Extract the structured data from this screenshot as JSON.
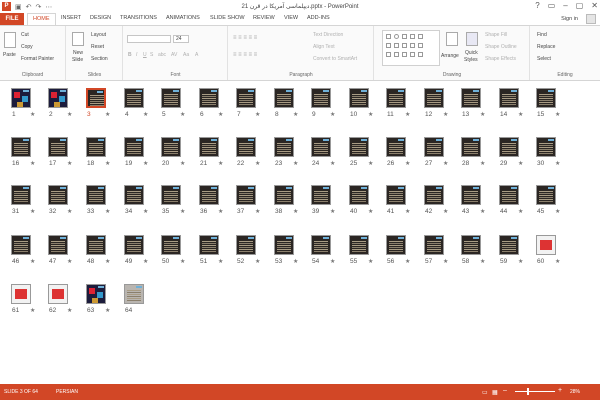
{
  "window": {
    "title": "21 دیپلماسی آمریکا در قرن.pptx - PowerPoint",
    "controls": [
      "?",
      "▭",
      "–",
      "▢",
      "✕"
    ]
  },
  "qat": {
    "logo": "P",
    "save": "▣",
    "undo": "↶",
    "redo": "↷",
    "customize": "⋯"
  },
  "tabs": [
    "FILE",
    "HOME",
    "INSERT",
    "DESIGN",
    "TRANSITIONS",
    "ANIMATIONS",
    "SLIDE SHOW",
    "REVIEW",
    "VIEW",
    "ADD-INS"
  ],
  "account": {
    "signin": "Sign in"
  },
  "ribbon": {
    "clipboard": {
      "paste": "Paste",
      "cut": "Cut",
      "copy": "Copy",
      "format_painter": "Format Painter",
      "label": "Clipboard"
    },
    "slides": {
      "new_slide_1": "New",
      "new_slide_2": "Slide",
      "layout": "Layout",
      "reset": "Reset",
      "section": "Section",
      "label": "Slides"
    },
    "font": {
      "size": "24",
      "bold": "B",
      "italic": "I",
      "underline": "U",
      "strike": "S",
      "shadow": "abc",
      "spacing": "AV",
      "case": "Aa",
      "color": "A",
      "label": "Font"
    },
    "paragraph": {
      "text_direction": "Text Direction",
      "align_text": "Align Text",
      "convert_smartart": "Convert to SmartArt",
      "label": "Paragraph"
    },
    "drawing": {
      "arrange": "Arrange",
      "quick_styles_1": "Quick",
      "quick_styles_2": "Styles",
      "shape_fill": "Shape Fill",
      "shape_outline": "Shape Outline",
      "shape_effects": "Shape Effects",
      "label": "Drawing"
    },
    "editing": {
      "find": "Find",
      "replace": "Replace",
      "select": "Select",
      "label": "Editing"
    }
  },
  "slides": [
    {
      "number": "1",
      "star": "★",
      "style": "photo"
    },
    {
      "number": "2",
      "star": "★",
      "style": "photo"
    },
    {
      "number": "3",
      "star": "★",
      "style": "selected"
    },
    {
      "number": "4",
      "star": "★"
    },
    {
      "number": "5",
      "star": "★"
    },
    {
      "number": "6",
      "star": "★"
    },
    {
      "number": "7",
      "star": "★"
    },
    {
      "number": "8",
      "star": "★"
    },
    {
      "number": "9",
      "star": "★"
    },
    {
      "number": "10",
      "star": "★"
    },
    {
      "number": "11",
      "star": "★"
    },
    {
      "number": "12",
      "star": "★"
    },
    {
      "number": "13",
      "star": "★"
    },
    {
      "number": "14",
      "star": "★"
    },
    {
      "number": "15",
      "star": "★"
    },
    {
      "number": "16",
      "star": "★"
    },
    {
      "number": "17",
      "star": "★"
    },
    {
      "number": "18",
      "star": "★"
    },
    {
      "number": "19",
      "star": "★"
    },
    {
      "number": "20",
      "star": "★"
    },
    {
      "number": "21",
      "star": "★"
    },
    {
      "number": "22",
      "star": "★"
    },
    {
      "number": "23",
      "star": "★"
    },
    {
      "number": "24",
      "star": "★"
    },
    {
      "number": "25",
      "star": "★"
    },
    {
      "number": "26",
      "star": "★"
    },
    {
      "number": "27",
      "star": "★"
    },
    {
      "number": "28",
      "star": "★"
    },
    {
      "number": "29",
      "star": "★"
    },
    {
      "number": "30",
      "star": "★"
    },
    {
      "number": "31",
      "star": "★"
    },
    {
      "number": "32",
      "star": "★"
    },
    {
      "number": "33",
      "star": "★"
    },
    {
      "number": "34",
      "star": "★"
    },
    {
      "number": "35",
      "star": "★"
    },
    {
      "number": "36",
      "star": "★"
    },
    {
      "number": "37",
      "star": "★"
    },
    {
      "number": "38",
      "star": "★"
    },
    {
      "number": "39",
      "star": "★"
    },
    {
      "number": "40",
      "star": "★"
    },
    {
      "number": "41",
      "star": "★"
    },
    {
      "number": "42",
      "star": "★"
    },
    {
      "number": "43",
      "star": "★"
    },
    {
      "number": "44",
      "star": "★"
    },
    {
      "number": "45",
      "star": "★"
    },
    {
      "number": "46",
      "star": "★"
    },
    {
      "number": "47",
      "star": "★"
    },
    {
      "number": "48",
      "star": "★"
    },
    {
      "number": "49",
      "star": "★"
    },
    {
      "number": "50",
      "star": "★"
    },
    {
      "number": "51",
      "star": "★"
    },
    {
      "number": "52",
      "star": "★"
    },
    {
      "number": "53",
      "star": "★"
    },
    {
      "number": "54",
      "star": "★"
    },
    {
      "number": "55",
      "star": "★"
    },
    {
      "number": "56",
      "star": "★"
    },
    {
      "number": "57",
      "star": "★"
    },
    {
      "number": "58",
      "star": "★"
    },
    {
      "number": "59",
      "star": "★"
    },
    {
      "number": "60",
      "star": "★",
      "style": "white"
    },
    {
      "number": "61",
      "star": "★",
      "style": "white"
    },
    {
      "number": "62",
      "star": "★",
      "style": "white"
    },
    {
      "number": "63",
      "star": "★",
      "style": "photo"
    },
    {
      "number": "64",
      "star": "",
      "style": "gray"
    }
  ],
  "status": {
    "slide_info": "SLIDE 3 OF 64",
    "language": "PERSIAN",
    "zoom": "28%",
    "zoom_minus": "–",
    "zoom_plus": "+"
  },
  "colors": {
    "accent": "#d24726"
  }
}
